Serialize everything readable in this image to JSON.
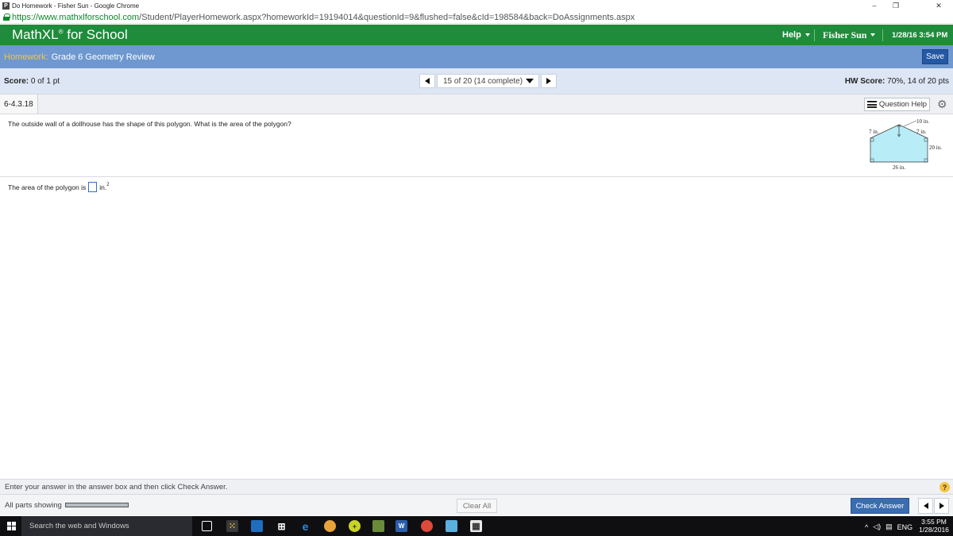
{
  "window": {
    "title": "Do Homework - Fisher Sun - Google Chrome",
    "favicon_letter": "P",
    "minimize": "–",
    "restore": "❐",
    "close": "✕"
  },
  "address": {
    "url_host": "https://www.mathxlforschool.com",
    "url_path": "/Student/PlayerHomework.aspx?homeworkId=19194014&questionId=9&flushed=false&cId=198584&back=DoAssignments.aspx"
  },
  "header": {
    "brand": "MathXL",
    "brand_mark": "®",
    "brand_suffix": " for School",
    "help": "Help",
    "user": "Fisher Sun",
    "datetime": "1/28/16 3:54 PM",
    "color": "#1e8c3a"
  },
  "homework": {
    "label": "Homework:",
    "name": "Grade 6 Geometry Review",
    "save": "Save"
  },
  "scorebar": {
    "score_label": "Score:",
    "score_value": "0 of 1 pt",
    "question_select": "15 of 20 (14 complete)",
    "hw_score_label": "HW Score:",
    "hw_score_value": "70%, 14 of 20 pts"
  },
  "question_bar": {
    "id": "6-4.3.18",
    "help": "Question Help"
  },
  "question": {
    "text": "The outside wall of a dollhouse has the shape of this polygon. What is the area of the polygon?",
    "answer_prefix": "The area of the polygon is",
    "answer_value": "",
    "answer_unit": "in.",
    "answer_exponent": "2"
  },
  "figure": {
    "labels": {
      "top": "10 in.",
      "left_slope": "7 in.",
      "right_slope": "7 in.",
      "right_side": "20 in.",
      "bottom": "26 in."
    },
    "fill": "#b8ecf7"
  },
  "footer": {
    "instruction": "Enter your answer in the answer box and then click Check Answer.",
    "help_icon": "?",
    "parts": "All parts showing",
    "parts_progress": 1.0,
    "clear_all": "Clear All",
    "check_answer": "Check Answer"
  },
  "taskbar": {
    "search": "Search the web and Windows",
    "language": "ENG",
    "time": "3:55 PM",
    "date": "1/28/2016"
  }
}
